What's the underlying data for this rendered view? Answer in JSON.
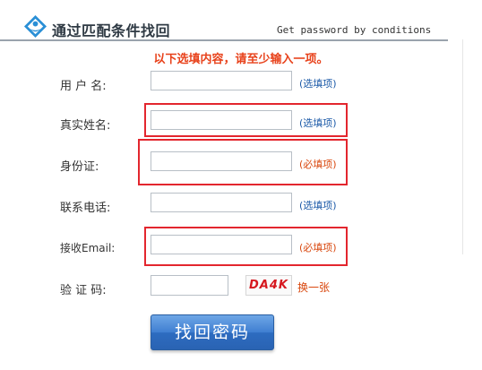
{
  "header": {
    "title": "通过匹配条件找回",
    "subtitle": "Get password by conditions"
  },
  "notice": "以下选填内容，请至少输入一项。",
  "fields": {
    "username": {
      "label": "用 户 名:",
      "value": "",
      "hint": "(选填项)"
    },
    "realname": {
      "label": "真实姓名:",
      "value": "",
      "hint": "(选填项)"
    },
    "idcard": {
      "label": "身份证:",
      "value": "",
      "hint": "(必填项)"
    },
    "phone": {
      "label": "联系电话:",
      "value": "",
      "hint": "(选填项)"
    },
    "email": {
      "label": "接收Email:",
      "value": "",
      "hint": "(必填项)"
    },
    "captcha": {
      "label": "验 证 码:",
      "value": "",
      "image_text": "DA4K",
      "refresh": "换一张"
    }
  },
  "submit_label": "找回密码",
  "colors": {
    "notice": "#e8421b",
    "optional_hint": "#1c5aa8",
    "required_hint": "#d9480f",
    "highlight_box": "#e3262e",
    "button": "#3f7fd1",
    "logo": "#2a8fd6"
  },
  "icons": {
    "logo": "blue-diamond-person-icon"
  }
}
